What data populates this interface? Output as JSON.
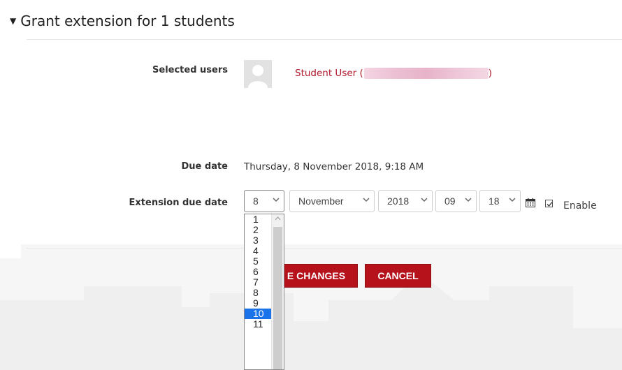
{
  "header": {
    "title": "Grant extension for 1 students"
  },
  "selected_users": {
    "label": "Selected users",
    "student_name": "Student User (",
    "student_suffix": ")"
  },
  "due_date": {
    "label": "Due date",
    "value": "Thursday, 8 November 2018, 9:18 AM"
  },
  "extension": {
    "label": "Extension due date",
    "day": "8",
    "month": "November",
    "year": "2018",
    "hour": "09",
    "minute": "18",
    "enable_label": "Enable",
    "enable_checked": true
  },
  "day_options": [
    "1",
    "2",
    "3",
    "4",
    "5",
    "6",
    "7",
    "8",
    "9",
    "10",
    "11"
  ],
  "day_highlighted": "10",
  "buttons": {
    "save_label": "E CHANGES",
    "cancel_label": "CANCEL"
  },
  "colors": {
    "accent": "#b5121b",
    "link": "#b1182b",
    "highlight": "#1a73e8"
  }
}
